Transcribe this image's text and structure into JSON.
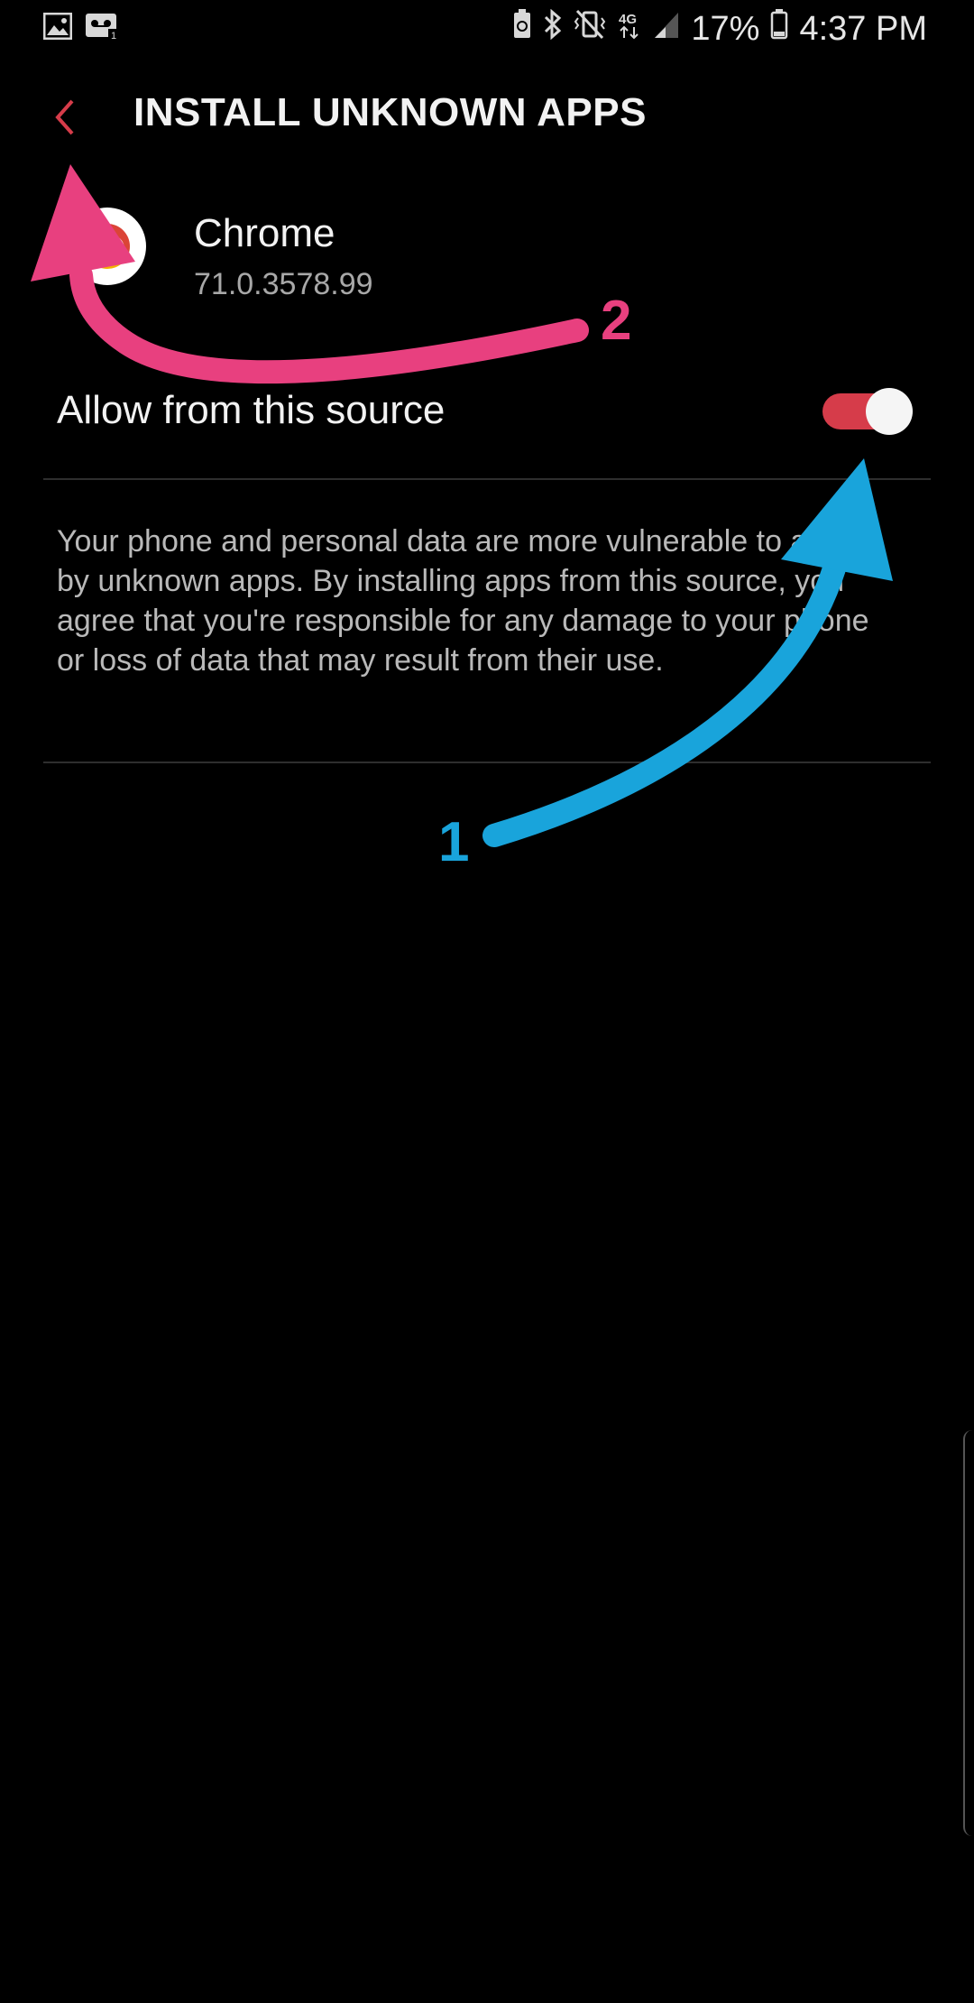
{
  "status_bar": {
    "battery": "17%",
    "time": "4:37 PM",
    "network": "4G",
    "icons_left": [
      "gallery-icon",
      "voicemail-icon"
    ],
    "icons_right": [
      "battery-saver-icon",
      "bluetooth-icon",
      "vibrate-mute-icon",
      "network-4g-icon",
      "signal-icon",
      "battery-icon"
    ]
  },
  "header": {
    "title": "INSTALL UNKNOWN APPS",
    "back_icon": "chevron-left-icon"
  },
  "app": {
    "name": "Chrome",
    "version": "71.0.3578.99",
    "icon": "chrome-icon"
  },
  "setting": {
    "label": "Allow from this source",
    "enabled": true
  },
  "warning": {
    "text": "Your phone and personal data are more vulnerable to attack by unknown apps. By installing apps from this source, you agree that you're responsible for any damage to your phone or loss of data that may result from their use."
  },
  "annotations": {
    "step_1": "1",
    "step_2": "2",
    "colors": {
      "step_1": "#19a4db",
      "step_2": "#e8407f"
    }
  },
  "colors": {
    "accent": "#d63c4a",
    "background": "#000000"
  }
}
